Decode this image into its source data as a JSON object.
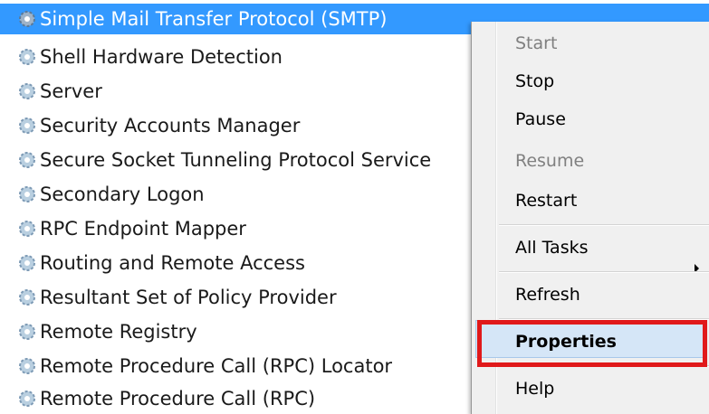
{
  "services": [
    {
      "name": "Simple Mail Transfer Protocol (SMTP)",
      "selected": true
    },
    {
      "name": "Shell Hardware Detection"
    },
    {
      "name": "Server"
    },
    {
      "name": "Security Accounts Manager"
    },
    {
      "name": "Secure Socket Tunneling Protocol Service"
    },
    {
      "name": "Secondary Logon"
    },
    {
      "name": "RPC Endpoint Mapper"
    },
    {
      "name": "Routing and Remote Access"
    },
    {
      "name": "Resultant Set of Policy Provider"
    },
    {
      "name": "Remote Registry"
    },
    {
      "name": "Remote Procedure Call (RPC) Locator"
    },
    {
      "name": "Remote Procedure Call (RPC)"
    }
  ],
  "context_menu": {
    "start": "Start",
    "stop": "Stop",
    "pause": "Pause",
    "resume": "Resume",
    "restart": "Restart",
    "all_tasks": "All Tasks",
    "refresh": "Refresh",
    "properties": "Properties",
    "help": "Help"
  },
  "colors": {
    "selection": "#3399ff",
    "highlight_box": "#e0191b",
    "menu_hover": "#d5e6f7"
  },
  "icons": {
    "service": "gear-icon",
    "submenu": "chevron-right-icon"
  }
}
